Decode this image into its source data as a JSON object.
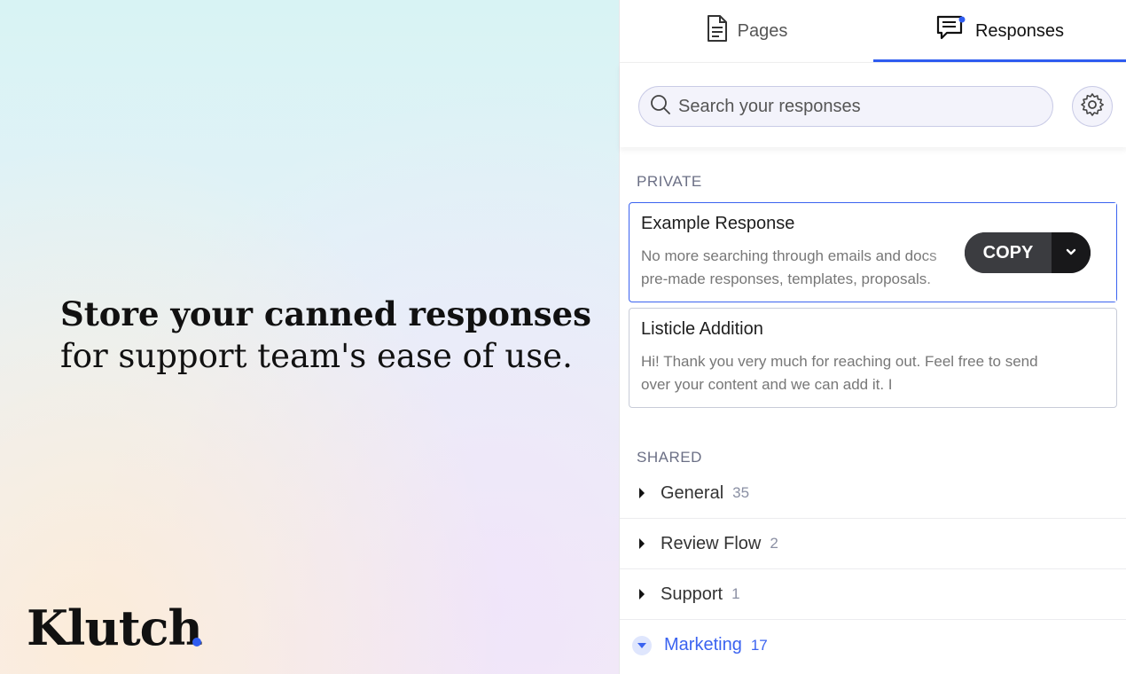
{
  "promo": {
    "headline_bold": "Store your canned responses",
    "headline_normal": "for support team's ease of use.",
    "logo": "Klutch",
    "accent_color": "#2f5cf0"
  },
  "tabs": [
    {
      "label": "Pages",
      "icon": "document-icon",
      "active": false
    },
    {
      "label": "Responses",
      "icon": "chat-icon",
      "active": true
    }
  ],
  "search": {
    "placeholder": "Search your responses",
    "value": ""
  },
  "sections": {
    "private_label": "PRIVATE",
    "shared_label": "SHARED"
  },
  "private_responses": [
    {
      "title": "Example Response",
      "body_line1": "No more searching through emails and docs",
      "body_line2": "pre-made responses, templates, proposals."
    },
    {
      "title": "Listicle Addition",
      "body_line1": "Hi! Thank you very much for reaching out. ​Feel free to send",
      "body_line2": "over your content and we can add it. I"
    }
  ],
  "copy_button": {
    "label": "COPY"
  },
  "shared_folders": [
    {
      "name": "General",
      "count": "35",
      "expanded": false
    },
    {
      "name": "Review Flow",
      "count": "2",
      "expanded": false
    },
    {
      "name": "Support",
      "count": "1",
      "expanded": false
    },
    {
      "name": "Marketing",
      "count": "17",
      "expanded": true
    }
  ]
}
